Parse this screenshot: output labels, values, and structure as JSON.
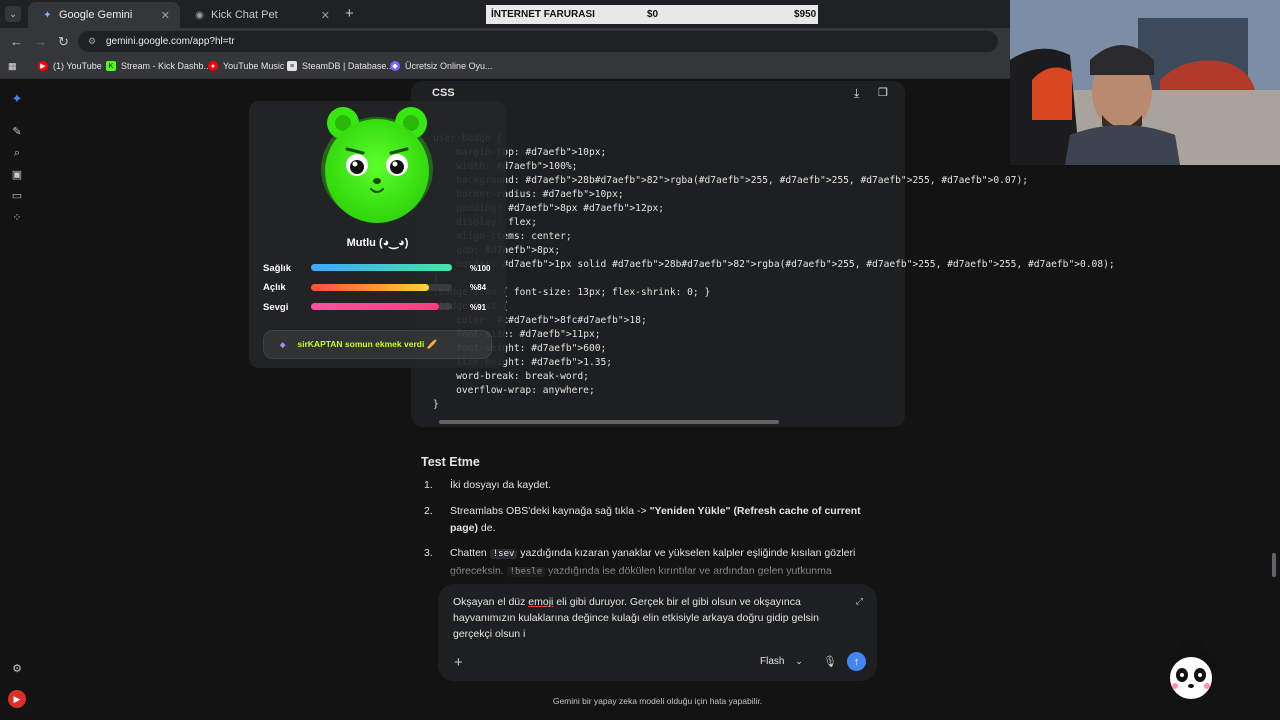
{
  "browser": {
    "tabs": [
      {
        "label": "Google Gemini",
        "icon": "gemini-icon",
        "active": true
      },
      {
        "label": "Kick Chat Pet",
        "icon": "page-icon",
        "active": false
      }
    ],
    "url": "gemini.google.com/app?hl=tr",
    "bookmarks": [
      {
        "label": "(1) YouTube",
        "icon": "youtube-icon",
        "color": "#ff0000"
      },
      {
        "label": "Stream - Kick Dashb...",
        "icon": "kick-icon",
        "color": "#53fc18"
      },
      {
        "label": "YouTube Music",
        "icon": "youtube-music-icon",
        "color": "#ff0000"
      },
      {
        "label": "SteamDB | Database...",
        "icon": "steamdb-icon",
        "color": "#e3e3e3"
      },
      {
        "label": "Ücretsiz Online Oyu...",
        "icon": "game-icon",
        "color": "#7b61ff"
      }
    ]
  },
  "overlay_bar": {
    "title": "İNTERNET FARURASI",
    "current": "$0",
    "goal": "$950"
  },
  "pet": {
    "name": "Mutlu (◕‿◕)",
    "stats": [
      {
        "label": "Sağlık",
        "value": "%100",
        "level": 1.0,
        "gradient": [
          "#3fa8ff",
          "#42e6a4"
        ]
      },
      {
        "label": "Açlık",
        "value": "%84",
        "level": 0.84,
        "gradient": [
          "#ff4e3a",
          "#ffd23a"
        ]
      },
      {
        "label": "Sevgi",
        "value": "%91",
        "level": 0.91,
        "gradient": [
          "#ff4fa0",
          "#ff3d7f"
        ]
      }
    ],
    "event": "sirKAPTAN somun ekmek verdi 🥖",
    "accent": "#c8fc18"
  },
  "code": {
    "language": "CSS",
    "lines": [
      "user-badge {",
      "    margin-top: 10px;",
      "    width: 100%;",
      "    background: rgba(255, 255, 255, 0.07);",
      "    border-radius: 10px;",
      "    padding: 8px 12px;",
      "    display: flex;",
      "    align-items: center;",
      "    gap: 8px;",
      "    border: 1px solid rgba(255, 255, 255, 0.08);",
      "}",
      ".badge-icon { font-size: 13px; flex-shrink: 0; }",
      ".badge-text {",
      "    color: #c8fc18;",
      "    font-size: 11px;",
      "    font-weight: 600;",
      "    line-height: 1.35;",
      "    word-break: break-word;",
      "    overflow-wrap: anywhere;",
      "}"
    ]
  },
  "content": {
    "heading": "Test Etme",
    "steps": [
      {
        "num": "1.",
        "parts": [
          {
            "t": "İki dosyayı da kaydet."
          }
        ]
      },
      {
        "num": "2.",
        "parts": [
          {
            "t": "Streamlabs OBS'deki kaynağa sağ tıkla -> "
          },
          {
            "t": "\"Yeniden Yükle\" (Refresh cache of current page)",
            "b": true
          },
          {
            "t": " de."
          }
        ]
      },
      {
        "num": "3.",
        "parts": [
          {
            "t": "Chatten "
          },
          {
            "t": "!sev",
            "c": true
          },
          {
            "t": " yazdığında kızaran yanaklar ve yükselen kalpler eşliğinde kısılan gözleri göreceksin. "
          },
          {
            "t": "!besle",
            "c": true
          },
          {
            "t": " yazdığında ise dökülen kırıntılar ve ardından gelen yutkunma"
          }
        ]
      }
    ]
  },
  "prompt": {
    "before": "Okşayan el düz ",
    "error_word": "emoji",
    "after": " eli gibi duruyor. Gerçek bir el gibi olsun ve okşayınca hayvanımızın kulaklarına değince kulağı elin etkisiyle arkaya doğru gidip gelsin gerçekçi olsun i",
    "model": "Flash"
  },
  "disclaimer": "Gemini bir yapay zeka modeli olduğu için hata yapabilir."
}
